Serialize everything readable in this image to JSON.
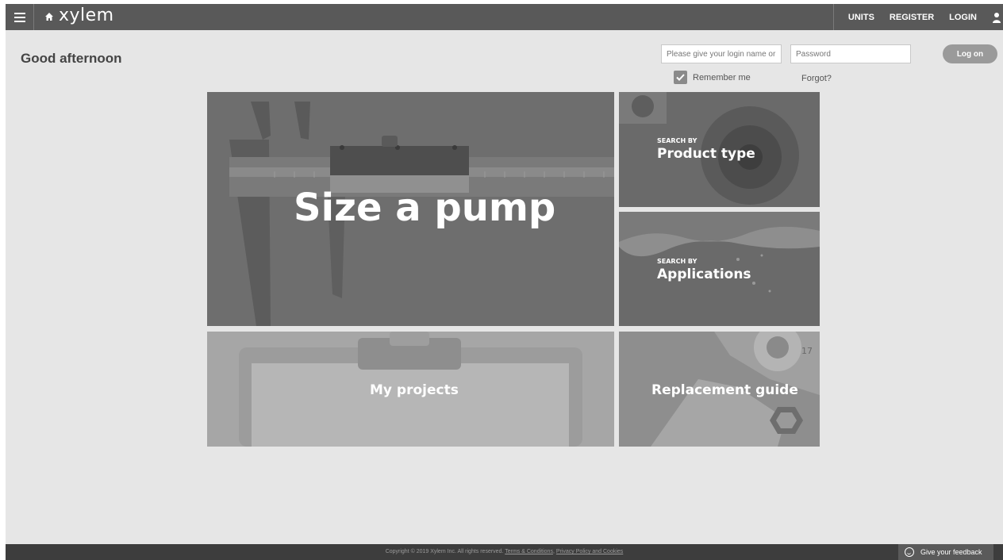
{
  "header": {
    "brand": "xylem",
    "nav": {
      "units": "UNITS",
      "register": "REGISTER",
      "login": "LOGIN"
    }
  },
  "greeting": "Good afternoon",
  "login": {
    "name_placeholder": "Please give your login name or",
    "password_placeholder": "Password",
    "logon_label": "Log on",
    "remember_label": "Remember me",
    "remember_checked": true,
    "forgot_label": "Forgot?"
  },
  "tiles": {
    "size_pump": {
      "title": "Size a pump"
    },
    "product_type": {
      "kicker": "SEARCH BY",
      "title": "Product type"
    },
    "applications": {
      "kicker": "SEARCH BY",
      "title": "Applications"
    },
    "my_projects": {
      "title": "My projects"
    },
    "replacement_guide": {
      "title": "Replacement guide",
      "wrench_number": "17"
    }
  },
  "footer": {
    "copyright": "Copyright © 2019 Xylem Inc. All rights reserved.",
    "terms_link": "Terms & Conditions",
    "separator": ",",
    "privacy_link": "Privacy Policy and Cookies",
    "feedback_label": "Give your feedback"
  }
}
